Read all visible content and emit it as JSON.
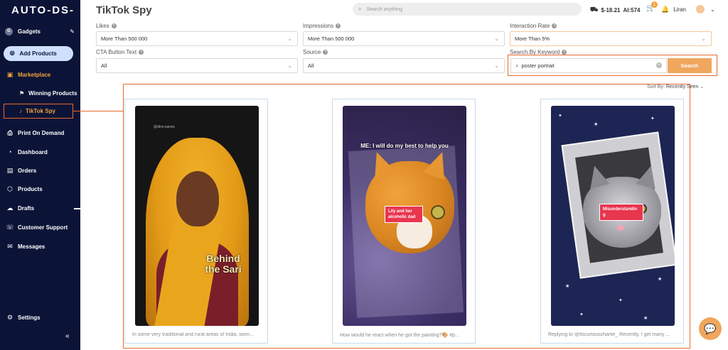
{
  "app": {
    "logo": "AUTO-DS-",
    "store": {
      "initial": "G",
      "name": "Gadgets"
    }
  },
  "sidebar": {
    "add_products": "Add Products",
    "marketplace": "Marketplace",
    "winning_products": "Winning Products",
    "tiktok_spy": "TikTok Spy",
    "items": [
      {
        "label": "Print On Demand",
        "icon": "print-icon"
      },
      {
        "label": "Dashboard",
        "icon": "dashboard-icon"
      },
      {
        "label": "Orders",
        "icon": "orders-icon"
      },
      {
        "label": "Products",
        "icon": "products-icon"
      },
      {
        "label": "Drafts",
        "icon": "drafts-icon"
      },
      {
        "label": "Customer Support",
        "icon": "support-icon"
      },
      {
        "label": "Messages",
        "icon": "messages-icon"
      }
    ],
    "settings": "Settings"
  },
  "header": {
    "title": "TikTok Spy",
    "search_placeholder": "Search anything",
    "balance": "$-18.21",
    "ai": "AI:574",
    "cart_count": "1",
    "user": "Liran"
  },
  "filters": {
    "likes": {
      "label": "Likes",
      "value": "More Than 500 000"
    },
    "impressions": {
      "label": "Impressions",
      "value": "More Than 500 000"
    },
    "interaction_rate": {
      "label": "Interaction Rate",
      "value": "More Than 5%"
    },
    "cta": {
      "label": "CTA Button Text",
      "value": "All"
    },
    "source": {
      "label": "Source",
      "value": "All"
    },
    "keyword": {
      "label": "Search By Keyword",
      "value": "poster portrait",
      "button": "Search"
    }
  },
  "sort": {
    "label": "Sort By:",
    "value": "Recently Seen"
  },
  "results": [
    {
      "caption": "In some very traditional and rural areas of India, wom...",
      "overlay": "Behind the Sari",
      "handle": "@dino.sarres"
    },
    {
      "caption": "How would he react when he got the painting?🎨 #p...",
      "overlay": "ME: I will do my best to help you",
      "tag": "Lily and her alcoholic dad"
    },
    {
      "caption": "Replying to @itscuriouscharlie_ Recently, I get many ...",
      "tag": "Misunderstandin g"
    }
  ]
}
